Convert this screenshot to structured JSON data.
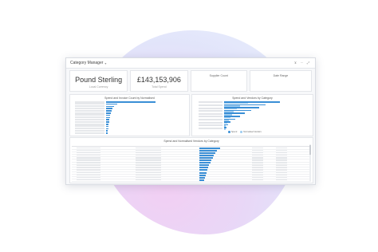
{
  "window": {
    "title": "Category Manager",
    "title_chevron": "▾",
    "icons": [
      "filter-icon",
      "more-icon",
      "expand-icon"
    ]
  },
  "kpis": [
    {
      "value": "Pound Sterling",
      "sub": "Local Currency"
    },
    {
      "value": "£143,153,906",
      "sub": "Total Spend"
    },
    {
      "label": "Supplier Count"
    },
    {
      "label": "Date Range"
    }
  ],
  "panels": {
    "left_title": "Spend and Invoice Count by Normalised",
    "right_title": "Spend and Vendors by Category",
    "table_title": "Spend and Normalised Vendors by Category"
  },
  "legend": {
    "items": [
      {
        "label": "Spend",
        "color": "#3a8fd6"
      },
      {
        "label": "Normalised Vendors",
        "color": "#9ccbef"
      }
    ]
  },
  "colors": {
    "accent": "#3a8fd6",
    "accent_light": "#5aaee8"
  }
}
